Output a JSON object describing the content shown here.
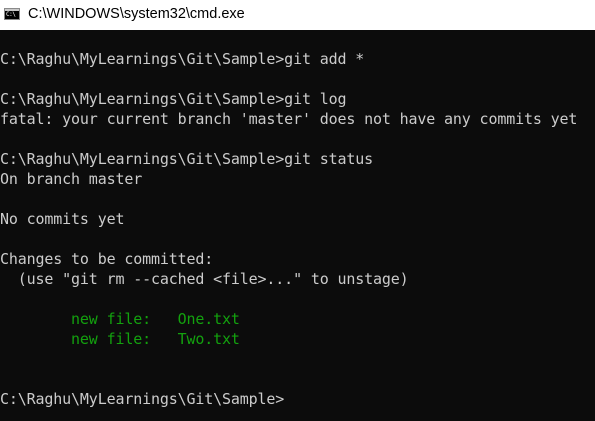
{
  "window": {
    "title": "C:\\WINDOWS\\system32\\cmd.exe",
    "icon": "cmd-console-icon",
    "icon_glyph": "C:\\"
  },
  "colors": {
    "console_background": "#0c0c0c",
    "console_text": "#cccccc",
    "staged_file_text": "#13a10e"
  },
  "console": {
    "lines": [
      {
        "text": "C:\\Raghu\\MyLearnings\\Git\\Sample>git add *"
      },
      {
        "text": "C:\\Raghu\\MyLearnings\\Git\\Sample>git log"
      },
      {
        "text": "fatal: your current branch 'master' does not have any commits yet"
      },
      {
        "text": "C:\\Raghu\\MyLearnings\\Git\\Sample>git status"
      },
      {
        "text": "On branch master"
      },
      {
        "text": "No commits yet"
      },
      {
        "text": "Changes to be committed:"
      },
      {
        "text": "  (use \"git rm --cached <file>...\" to unstage)"
      },
      {
        "text": "        new file:   One.txt"
      },
      {
        "text": "        new file:   Two.txt"
      },
      {
        "text": "C:\\Raghu\\MyLearnings\\Git\\Sample>"
      }
    ]
  }
}
